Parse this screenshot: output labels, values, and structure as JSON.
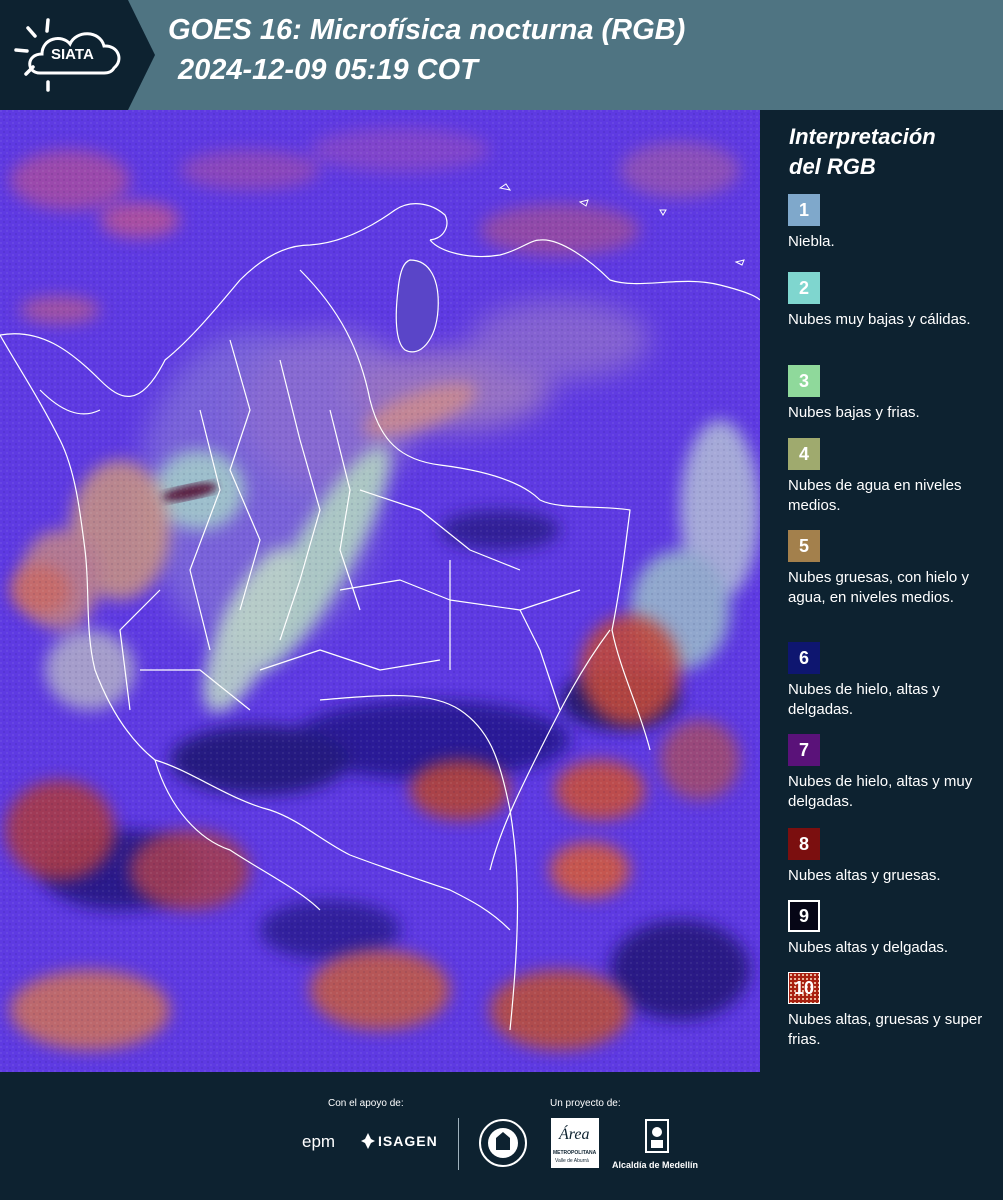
{
  "header": {
    "logo_text": "SIATA",
    "title_line1": "GOES 16: Microfísica nocturna (RGB)",
    "title_line2": "2024-12-09 05:19 COT"
  },
  "map": {
    "icon": "satellite-image-rgb-night-microphysics",
    "colors": {
      "base": "#5838e0",
      "high_thick": "#c0483a",
      "cold_cirrus": "#2a1e8a",
      "low_clouds": "#a9d6c0",
      "borders": "#ffffff"
    }
  },
  "legend": {
    "title_line1": "Interpretación",
    "title_line2": "del RGB",
    "items": [
      {
        "number": "1",
        "label": "Niebla.",
        "color": "#7fa8cb"
      },
      {
        "number": "2",
        "label": "Nubes muy bajas y cálidas.",
        "color": "#7fd6cf"
      },
      {
        "number": "3",
        "label": "Nubes bajas y frias.",
        "color": "#8fd99b"
      },
      {
        "number": "4",
        "label": "Nubes de agua en niveles medios.",
        "color": "#9faa6e"
      },
      {
        "number": "5",
        "label": "Nubes gruesas, con hielo y agua, en niveles medios.",
        "color": "#a3804c"
      },
      {
        "number": "6",
        "label": "Nubes de hielo, altas y delgadas.",
        "color": "#0e1670"
      },
      {
        "number": "7",
        "label": "Nubes de hielo, altas y muy delgadas.",
        "color": "#5a1279"
      },
      {
        "number": "8",
        "label": "Nubes altas y gruesas.",
        "color": "#7b0f0f"
      },
      {
        "number": "9",
        "label": "Nubes altas y delgadas.",
        "color": "#060616"
      },
      {
        "number": "10",
        "label": "Nubes altas, gruesas y super frias.",
        "color": "#a8200f"
      }
    ]
  },
  "footer": {
    "support_caption": "Con el apoyo de:",
    "project_caption": "Un proyecto de:",
    "sponsors": [
      "epm",
      "ISAGEN"
    ],
    "area_logo_text": "Área",
    "area_logo_sub": "METROPOLITANA",
    "area_logo_sub2": "Valle de Aburrá",
    "medellin_label": "Alcaldía de Medellín"
  }
}
